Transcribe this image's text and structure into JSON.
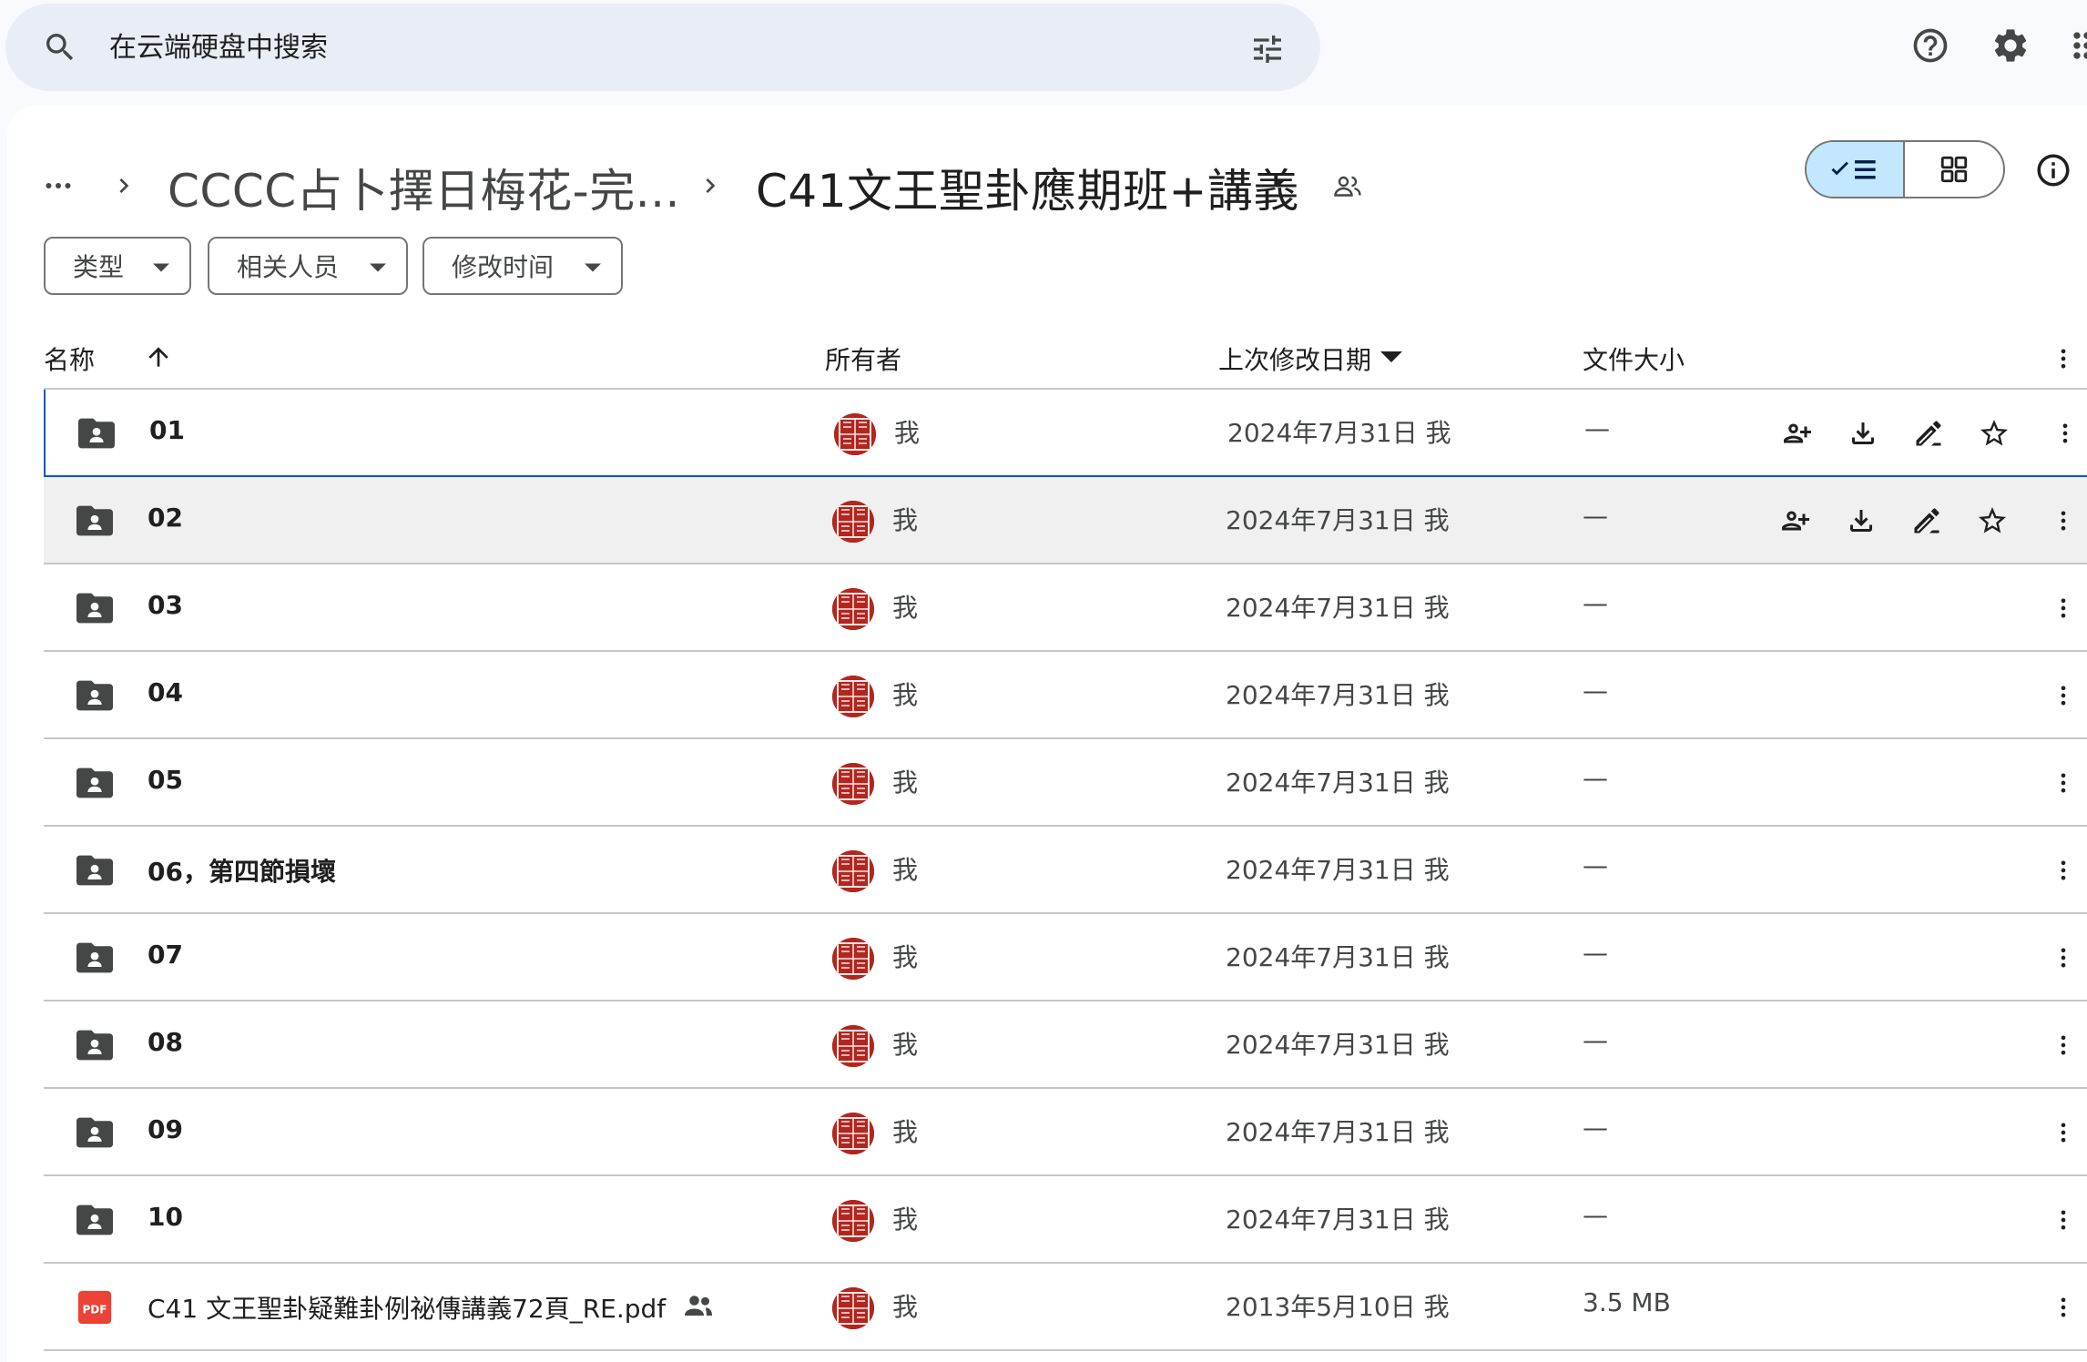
{
  "search": {
    "placeholder": "在云端硬盘中搜索"
  },
  "breadcrumb": {
    "more": "…",
    "parent": "CCCC占卜擇日梅花-完...",
    "current": "C41文王聖卦應期班+講義"
  },
  "filters": {
    "type": "类型",
    "people": "相关人员",
    "modified": "修改时间"
  },
  "columns": {
    "name": "名称",
    "owner": "所有者",
    "modified": "上次修改日期",
    "size": "文件大小"
  },
  "files": [
    {
      "name": "01",
      "kind": "shared-folder",
      "owner": "我",
      "modified": "2024年7月31日 我",
      "size": "—",
      "state": "selected"
    },
    {
      "name": "02",
      "kind": "shared-folder",
      "owner": "我",
      "modified": "2024年7月31日 我",
      "size": "—",
      "state": "hover"
    },
    {
      "name": "03",
      "kind": "shared-folder",
      "owner": "我",
      "modified": "2024年7月31日 我",
      "size": "—",
      "state": ""
    },
    {
      "name": "04",
      "kind": "shared-folder",
      "owner": "我",
      "modified": "2024年7月31日 我",
      "size": "—",
      "state": ""
    },
    {
      "name": "05",
      "kind": "shared-folder",
      "owner": "我",
      "modified": "2024年7月31日 我",
      "size": "—",
      "state": ""
    },
    {
      "name": "06，第四節損壞",
      "kind": "shared-folder",
      "owner": "我",
      "modified": "2024年7月31日 我",
      "size": "—",
      "state": ""
    },
    {
      "name": "07",
      "kind": "shared-folder",
      "owner": "我",
      "modified": "2024年7月31日 我",
      "size": "—",
      "state": ""
    },
    {
      "name": "08",
      "kind": "shared-folder",
      "owner": "我",
      "modified": "2024年7月31日 我",
      "size": "—",
      "state": ""
    },
    {
      "name": "09",
      "kind": "shared-folder",
      "owner": "我",
      "modified": "2024年7月31日 我",
      "size": "—",
      "state": ""
    },
    {
      "name": "10",
      "kind": "shared-folder",
      "owner": "我",
      "modified": "2024年7月31日 我",
      "size": "—",
      "state": ""
    },
    {
      "name": "C41 文王聖卦疑難卦例祕傳講義72頁_RE.pdf",
      "kind": "pdf",
      "owner": "我",
      "modified": "2013年5月10日 我",
      "size": "3.5 MB",
      "state": "",
      "shared": true
    }
  ],
  "icons": {
    "pdf_label": "PDF"
  },
  "colors": {
    "accent": "#0b57d0",
    "toggle_active": "#c2e7ff",
    "search_bg": "#e9eef6",
    "pdf": "#ea4335",
    "avatar": "#b3261e"
  }
}
